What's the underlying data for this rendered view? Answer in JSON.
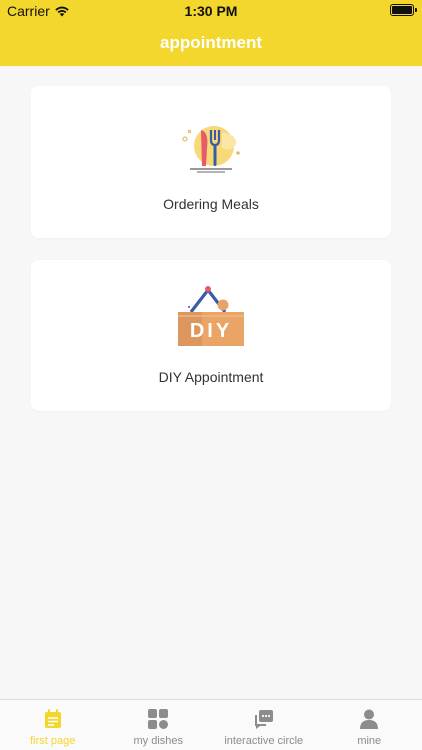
{
  "status_bar": {
    "carrier": "Carrier",
    "time": "1:30 PM"
  },
  "header": {
    "title": "appointment",
    "background": "#f3d72c"
  },
  "cards": [
    {
      "label": "Ordering Meals",
      "icon": "fork-knife-icon"
    },
    {
      "label": "DIY Appointment",
      "icon": "diy-sign-icon",
      "icon_text": "DIY"
    }
  ],
  "tabbar": {
    "active_color": "#f3d72c",
    "inactive_color": "#8c8c8c",
    "tabs": [
      {
        "label": "first page",
        "icon": "calendar-icon",
        "active": true
      },
      {
        "label": "my dishes",
        "icon": "grid-icon",
        "active": false
      },
      {
        "label": "interactive circle",
        "icon": "chat-icon",
        "active": false
      },
      {
        "label": "mine",
        "icon": "person-icon",
        "active": false
      }
    ]
  }
}
